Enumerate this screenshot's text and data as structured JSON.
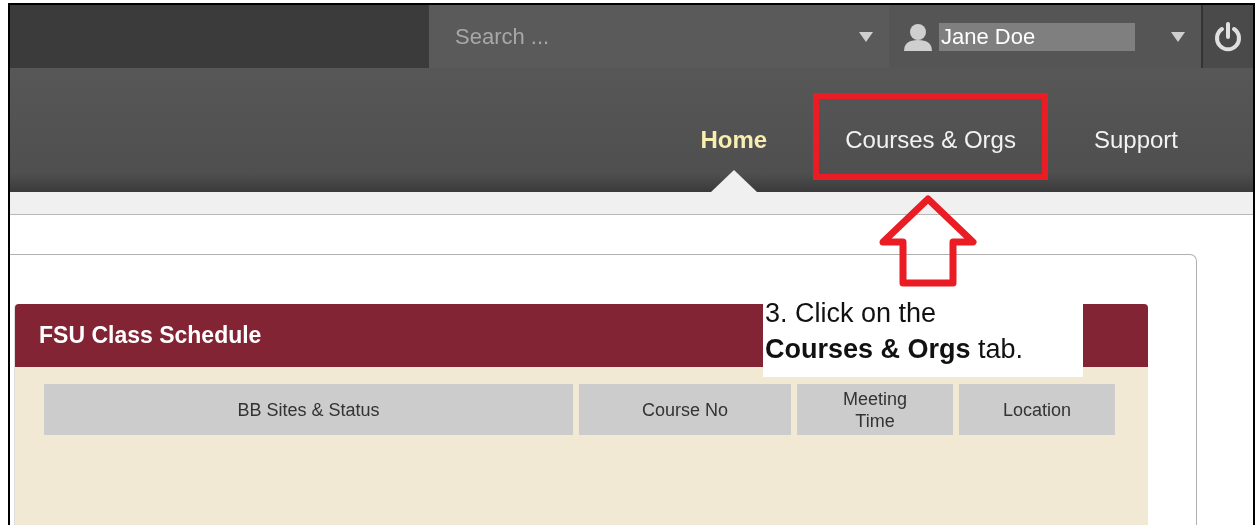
{
  "search": {
    "placeholder": "Search ..."
  },
  "user": {
    "name": "Jane Doe"
  },
  "tabs": [
    {
      "label": "Home",
      "selected": true,
      "highlighted": false
    },
    {
      "label": "Courses & Orgs",
      "selected": false,
      "highlighted": true
    },
    {
      "label": "Support",
      "selected": false,
      "highlighted": false
    }
  ],
  "module": {
    "title": "FSU Class Schedule",
    "columns": [
      "BB Sites & Status",
      "Course No",
      "Meeting Time",
      "Location"
    ]
  },
  "annotation": {
    "text": "3. Click on the\n**Courses & Orgs** tab."
  }
}
